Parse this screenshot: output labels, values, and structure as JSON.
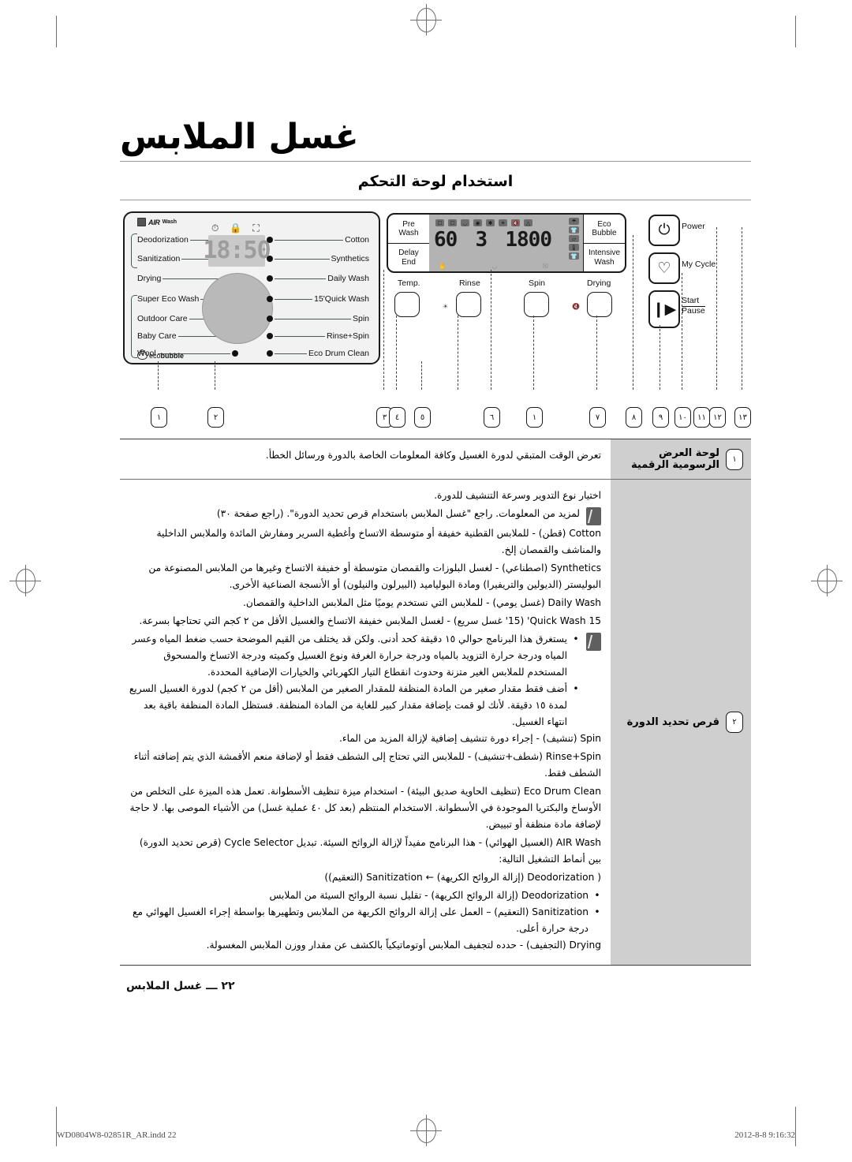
{
  "header": {
    "title": "غسل الملابس",
    "subtitle": "استخدام لوحة التحكم"
  },
  "control_panel": {
    "brand_airwash": {
      "name": "AIR",
      "suffix": "Wash"
    },
    "brand_ecobubble": {
      "eco": "eco",
      "bubble": "bubble"
    },
    "left_cycles": [
      {
        "label": "Deodorization"
      },
      {
        "label": "Sanitization"
      },
      {
        "label": "Drying"
      },
      {
        "label": "Super Eco Wash"
      },
      {
        "label": "Outdoor Care"
      },
      {
        "label": "Baby Care"
      },
      {
        "label": "Wool"
      }
    ],
    "right_cycles": [
      {
        "label": "Cotton"
      },
      {
        "label": "Synthetics"
      },
      {
        "label": "Daily Wash"
      },
      {
        "label": "15'Quick Wash"
      },
      {
        "label": "Spin"
      },
      {
        "label": "Rinse+Spin"
      },
      {
        "label": "Eco Drum Clean"
      }
    ],
    "small_display": {
      "value": "18:50",
      "icons": [
        "timer-icon",
        "lock-icon",
        "detergent-icon"
      ]
    },
    "module": {
      "left_buttons": [
        {
          "line1": "Pre",
          "line2": "Wash"
        },
        {
          "line1": "Delay",
          "line2": "End"
        }
      ],
      "right_buttons": [
        {
          "line1": "Eco",
          "line2": "Bubble"
        },
        {
          "line1": "Intensive",
          "line2": "Wash"
        }
      ],
      "digits": {
        "temp": "60",
        "rinse": "3",
        "spin": "1800"
      }
    },
    "option_buttons": [
      {
        "label": "Temp."
      },
      {
        "label": "Rinse"
      },
      {
        "label": "Spin"
      },
      {
        "label": "Drying"
      }
    ],
    "action_buttons": [
      {
        "label": "Power",
        "icon": "power-icon"
      },
      {
        "label": "My Cycle",
        "icon": "heart-icon"
      },
      {
        "label_top": "Start",
        "label_bottom": "Pause",
        "icon": "play-pause-icon"
      }
    ],
    "callouts": [
      "١",
      "٢",
      "٣",
      "٤",
      "٥",
      "٦",
      "١",
      "٧",
      "٨",
      "٩",
      "١٠",
      "١١",
      "١٢",
      "١٣"
    ]
  },
  "table": {
    "rows": [
      {
        "num": "١",
        "name": "لوحة العرض الرسومية الرقمية",
        "paragraphs": [
          "تعرض الوقت المتبقي لدورة الغسيل وكافة المعلومات الخاصة بالدورة ورسائل الخطأ."
        ]
      },
      {
        "num": "٢",
        "name": "قرص تحديد الدورة",
        "intro": "اختيار نوع التدوير وسرعة التنشيف للدورة.",
        "note1": "لمزيد من المعلومات. راجع \"غسل الملابس باستخدام قرص تحديد الدورة\". (راجع صفحة ٣٠)",
        "cycles": [
          "Cotton (قطن) - للملابس القطنية خفيفة أو متوسطة الاتساخ وأغطية السرير ومفارش المائدة والملابس الداخلية والمناشف والقمصان إلخ.",
          "Synthetics (اصطناعي) - لغسل البلوزات والقمصان متوسطة أو خفيفة الاتساخ وغيرها من الملابس المصنوعة من البوليستر (الديولين والتريفيرا) ومادة البولياميد (البيرلون والنيلون) أو الأنسجة الصناعية الأخرى.",
          "Daily Wash (غسل يومي) - للملابس التي نستخدم يوميًا مثل الملابس الداخلية والقمصان.",
          "Quick Wash 15' (15' غسل سريع) - لغسل الملابس خفيفة الاتساخ والغسيل الأقل من ٢ كجم التي تحتاجها بسرعة."
        ],
        "bullets": [
          "يستغرق هذا البرنامج حوالي ١٥ دقيقة كحد أدنى. ولكن قد يختلف من القيم الموضحة حسب ضغط المياه وعسر المياه ودرجة حرارة التزويد بالمياه ودرجة حرارة الغرفة ونوع الغسيل وكميته ودرجة الاتساخ والمسحوق المستخدم للملابس الغير متزنة وحدوث انقطاع التيار الكهربائي والخيارات الإضافية المحددة.",
          "أضف فقط مقدار صغير من المادة المنظفة للمقدار الصغير من الملابس (أقل من ٢ كجم) لدورة الغسيل السريع لمدة ١٥ دقيقة. لأنك لو قمت بإضافة مقدار كبير للغاية من المادة المنظفة. فستظل المادة المنظفة باقية بعد انتهاء الغسيل."
        ],
        "cycles2": [
          "Spin (تنشيف) - إجراء دورة تنشيف إضافية لإزالة المزيد من الماء.",
          "Rinse+Spin (شطف+تنشيف) - للملابس التي تحتاج إلى الشطف فقط أو لإضافة منعم الأقمشة الذي يتم إضافته أثناء الشطف فقط.",
          "Eco Drum Clean (تنظيف الحاوية صديق البيئة) - استخدام ميزة تنظيف الأسطوانة. تعمل هذه الميزة على التخلص من الأوساخ والبكتريا الموجودة في الأسطوانة. الاستخدام المنتظم (بعد كل ٤٠ عملية غسل) من الأشياء الموصى بها. لا حاجة لإضافة مادة منظفة أو تبييض.",
          "AIR Wash (الغسيل الهوائي) - هذا البرنامج مفيداً لإزالة الروائح السيئة. تبديل Cycle Selector (قرص تحديد الدورة) بين أنماط التشغيل التالية:"
        ],
        "flow": "( Deodorization (إزالة الروائح الكريهة) ← Sanitization (التعقيم))",
        "bullets2": [
          "Deodorization (إزالة الروائح الكريهة) - تقليل نسبة الروائح السيئة من الملابس",
          "Sanitization (التعقيم) – العمل على إزالة الروائح الكريهة من الملابس وتطهيرها بواسطة إجراء الغسيل الهوائي مع درجة حرارة أعلى."
        ],
        "last": "Drying (التجفيف) - حدده لتجفيف الملابس أوتوماتيكياً بالكشف عن مقدار ووزن الملابس المغسولة."
      }
    ]
  },
  "footer": {
    "page_label": "٢٢ ـــ غسل الملابس",
    "file": "WD0804W8-02851R_AR.indd  22",
    "timestamp": "2012-8-8   9:16:32"
  }
}
